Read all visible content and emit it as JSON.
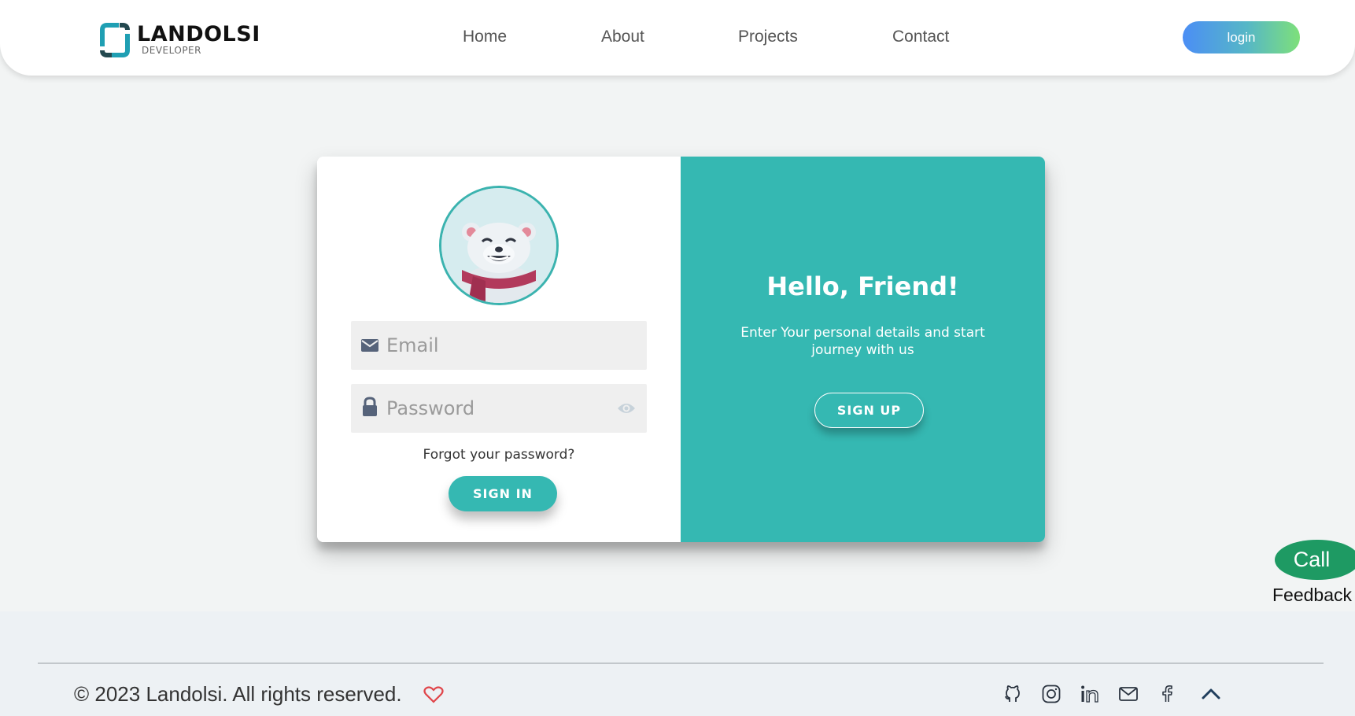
{
  "header": {
    "brand": "LANDOLSI",
    "brand_sub": "DEVELOPER",
    "nav": [
      {
        "label": "Home"
      },
      {
        "label": "About"
      },
      {
        "label": "Projects"
      },
      {
        "label": "Contact"
      }
    ],
    "login_label": "login"
  },
  "signin": {
    "email_placeholder": "Email",
    "password_placeholder": "Password",
    "forgot_label": "Forgot your password?",
    "button_label": "SIGN IN"
  },
  "overlay": {
    "title": "Hello, Friend!",
    "subtitle": "Enter Your personal details and start journey with us",
    "button_label": "SIGN UP"
  },
  "feedback": {
    "call_label": "Call",
    "label": "Feedback"
  },
  "footer": {
    "copyright": "© 2023 Landolsi. All rights reserved.",
    "social": [
      "github-icon",
      "instagram-icon",
      "linkedin-icon",
      "mail-icon",
      "facebook-icon",
      "scroll-top-icon"
    ]
  },
  "colors": {
    "accent": "#35b8b2",
    "call_green": "#1e9a63",
    "heart": "#e0454a",
    "page_bg": "#f2f4f4"
  }
}
